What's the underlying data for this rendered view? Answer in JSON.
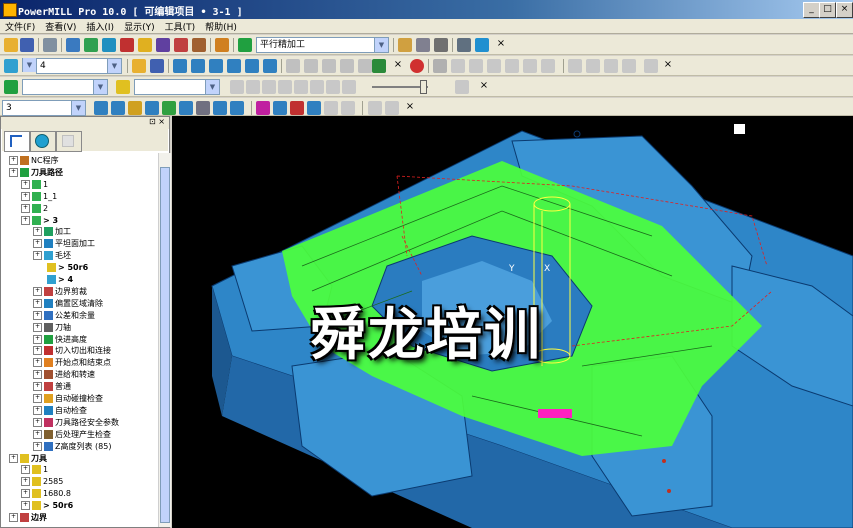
{
  "window": {
    "title": "PowerMILL Pro 10.0    [ 可编辑项目 • 3-1 ]",
    "controls": [
      "_",
      "□",
      "×"
    ]
  },
  "menu": [
    "文件(F)",
    "查看(V)",
    "插入(I)",
    "显示(Y)",
    "工具(T)",
    "帮助(H)"
  ],
  "toolbar1": {
    "strategy_combo": "平行精加工",
    "close": "×"
  },
  "toolbar2": {
    "layer_combo": "4",
    "close": "×"
  },
  "toolbar3": {
    "combo_a": "",
    "combo_b": "",
    "close": "×"
  },
  "toolbar4": {
    "combo": "3",
    "close": "×"
  },
  "explorer": {
    "pin": "⊡ ×",
    "tree": [
      {
        "label": "NC程序",
        "level": 0,
        "icon": "nc-program-icon"
      },
      {
        "label": "刀具路径",
        "level": 0,
        "icon": "toolpaths-icon",
        "bold": true
      },
      {
        "label": "1",
        "level": 1,
        "icon": "toolpath-icon"
      },
      {
        "label": "1_1",
        "level": 1,
        "icon": "toolpath-icon"
      },
      {
        "label": "2",
        "level": 1,
        "icon": "toolpath-icon"
      },
      {
        "label": "> 3",
        "level": 1,
        "icon": "toolpath-icon",
        "bold": true
      },
      {
        "label": "加工",
        "level": 2,
        "icon": "machining-icon"
      },
      {
        "label": "平坦面加工",
        "level": 2,
        "icon": "flat-machining-icon"
      },
      {
        "label": "毛坯",
        "level": 2,
        "icon": "block-icon"
      },
      {
        "label": "> 50r6",
        "level": 3,
        "icon": "tool-icon",
        "bold": true
      },
      {
        "label": "> 4",
        "level": 3,
        "icon": "layer-icon",
        "bold": true
      },
      {
        "label": "边界剪裁",
        "level": 2,
        "icon": "boundary-trim-icon"
      },
      {
        "label": "偏置区域清除",
        "level": 2,
        "icon": "offset-clear-icon"
      },
      {
        "label": "公差和余量",
        "level": 2,
        "icon": "tolerance-icon"
      },
      {
        "label": "刀轴",
        "level": 2,
        "icon": "tool-axis-icon"
      },
      {
        "label": "快进高度",
        "level": 2,
        "icon": "rapid-height-icon"
      },
      {
        "label": "切入切出和连接",
        "level": 2,
        "icon": "leads-links-icon"
      },
      {
        "label": "开始点和结束点",
        "level": 2,
        "icon": "start-end-icon"
      },
      {
        "label": "进给和转速",
        "level": 2,
        "icon": "feeds-speeds-icon"
      },
      {
        "label": "普通",
        "level": 2,
        "icon": "general-icon"
      },
      {
        "label": "自动碰撞检查",
        "level": 2,
        "icon": "collision-icon"
      },
      {
        "label": "自动检查",
        "level": 2,
        "icon": "auto-verify-icon"
      },
      {
        "label": "刀具路径安全参数",
        "level": 2,
        "icon": "safety-icon"
      },
      {
        "label": "后处理产生检查",
        "level": 2,
        "icon": "postprocess-icon"
      },
      {
        "label": "Z高度列表 (85)",
        "level": 2,
        "icon": "z-heights-icon"
      },
      {
        "label": "刀具",
        "level": 0,
        "icon": "tools-icon",
        "bold": true
      },
      {
        "label": "1",
        "level": 1,
        "icon": "tool-icon"
      },
      {
        "label": "2585",
        "level": 1,
        "icon": "tool-icon"
      },
      {
        "label": "1680.8",
        "level": 1,
        "icon": "tool-icon"
      },
      {
        "label": "> 50r6",
        "level": 1,
        "icon": "tool-icon",
        "bold": true
      },
      {
        "label": "边界",
        "level": 0,
        "icon": "boundaries-icon",
        "bold": true
      }
    ]
  },
  "viewport": {
    "watermark": "舜龙培训",
    "axis_labels": [
      "Y",
      "X"
    ]
  },
  "colors": {
    "part_blue": "#2e86c8",
    "toolpath_green": "#4cff3c",
    "background": "#000000",
    "title_bar": "#0a246a"
  }
}
